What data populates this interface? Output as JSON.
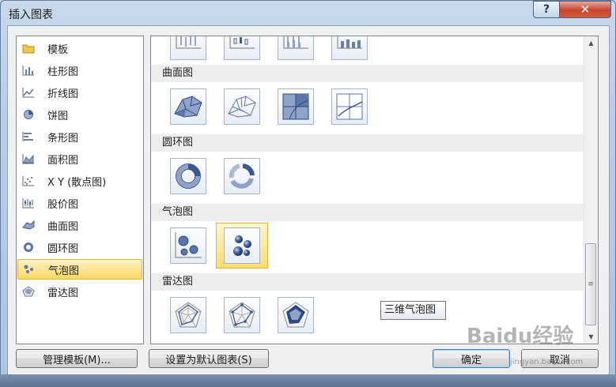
{
  "window": {
    "title": "插入图表",
    "help_label": "?",
    "close_label": "✕"
  },
  "categories": [
    {
      "label": "模板",
      "icon": "folder-icon"
    },
    {
      "label": "柱形图",
      "icon": "column-chart-icon"
    },
    {
      "label": "折线图",
      "icon": "line-chart-icon"
    },
    {
      "label": "饼图",
      "icon": "pie-chart-icon"
    },
    {
      "label": "条形图",
      "icon": "bar-chart-icon"
    },
    {
      "label": "面积图",
      "icon": "area-chart-icon"
    },
    {
      "label": "X Y (散点图)",
      "icon": "scatter-chart-icon"
    },
    {
      "label": "股价图",
      "icon": "stock-chart-icon"
    },
    {
      "label": "曲面图",
      "icon": "surface-chart-icon"
    },
    {
      "label": "圆环图",
      "icon": "doughnut-chart-icon"
    },
    {
      "label": "气泡图",
      "icon": "bubble-chart-icon",
      "selected": true
    },
    {
      "label": "雷达图",
      "icon": "radar-chart-icon"
    }
  ],
  "gallery": {
    "sections": [
      {
        "label": "曲面图"
      },
      {
        "label": "圆环图"
      },
      {
        "label": "气泡图"
      },
      {
        "label": "雷达图"
      }
    ],
    "tooltip": "三维气泡图"
  },
  "buttons": {
    "manage_templates": "管理模板(M)...",
    "set_default": "设置为默认图表(S)",
    "ok": "确定",
    "cancel": "取消"
  },
  "watermark": {
    "text": "Baidu经验",
    "sub": "jingyan.baidu.com"
  },
  "colors": {
    "accent": "#ffd863",
    "chart_blue": "#5b77aa",
    "chart_dark": "#2d4a7e"
  }
}
